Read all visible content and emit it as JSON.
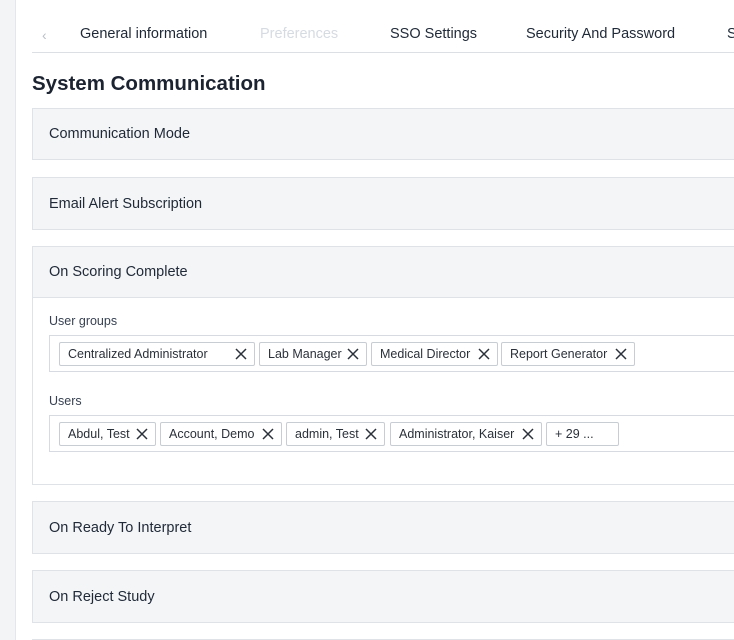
{
  "tabs": [
    {
      "label": "General information",
      "disabled": false
    },
    {
      "label": "Preferences",
      "disabled": true
    },
    {
      "label": "SSO Settings",
      "disabled": false
    },
    {
      "label": "Security And Password",
      "disabled": false
    },
    {
      "label": "S",
      "disabled": false
    }
  ],
  "page_title": "System Communication",
  "sections": {
    "communication_mode": "Communication Mode",
    "email_alert_subscription": "Email Alert Subscription",
    "on_scoring_complete": "On Scoring Complete",
    "on_ready_to_interpret": "On Ready To Interpret",
    "on_reject_study": "On Reject Study"
  },
  "scoring_complete": {
    "user_groups_label": "User groups",
    "user_groups": [
      "Centralized Administrator",
      "Lab Manager",
      "Medical Director",
      "Report Generator"
    ],
    "users_label": "Users",
    "users": [
      "Abdul, Test",
      "Account, Demo",
      "admin, Test",
      "Administrator, Kaiser"
    ],
    "users_more": "+ 29 ..."
  },
  "icons": {
    "tab_back": "chevron-left-icon",
    "chip_remove": "close-icon"
  }
}
